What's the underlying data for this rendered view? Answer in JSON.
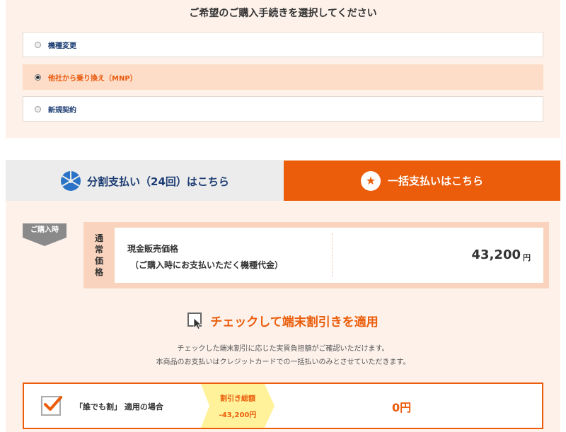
{
  "procedure": {
    "title": "ご希望のご購入手続きを選択してください",
    "options": [
      {
        "label": "機種変更",
        "selected": false
      },
      {
        "label": "他社から乗り換え（MNP）",
        "selected": true
      },
      {
        "label": "新規契約",
        "selected": false
      }
    ]
  },
  "tabs": {
    "installment_label": "分割支払い（24回）はこちら",
    "lump_label": "一括支払いはこちら",
    "active": "lump"
  },
  "purchase": {
    "badge": "ご購入時",
    "side_label": [
      "通",
      "常",
      "価",
      "格"
    ],
    "price_label_line1": "現金販売価格",
    "price_label_line2": "（ご購入時にお支払いただく機種代金）",
    "price_value": "43,200",
    "price_unit": "円"
  },
  "check": {
    "heading": "チェックして端末割引きを適用",
    "note_line1": "チェックした端末割引に応じた実質負担額がご確認いただけます。",
    "note_line2": "本商品のお支払いはクレジットカードでの一括払いのみとさせていただきます。"
  },
  "discount": {
    "label": "「誰でも割」 適用の場合",
    "checked": true,
    "tag_title": "割引き総額",
    "tag_amount": "-43,200円",
    "result": "0円"
  },
  "colors": {
    "accent": "#eb5d0b",
    "navy": "#1c3d73",
    "section_bg": "#fdf1ea",
    "tag_yellow": "#fff29a"
  }
}
